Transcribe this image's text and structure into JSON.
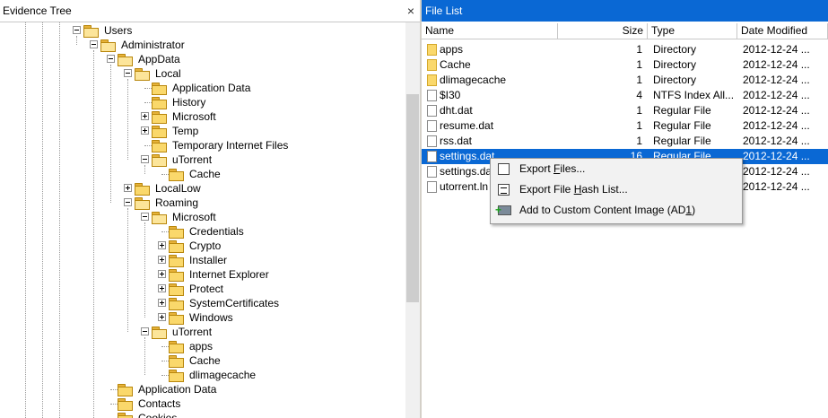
{
  "left_panel": {
    "title": "Evidence Tree",
    "close_glyph": "×"
  },
  "right_panel": {
    "title": "File List"
  },
  "tree": [
    {
      "label": "Users",
      "depth": 0,
      "expander": "minus",
      "open": true
    },
    {
      "label": "Administrator",
      "depth": 1,
      "expander": "minus",
      "open": true
    },
    {
      "label": "AppData",
      "depth": 2,
      "expander": "minus",
      "open": true
    },
    {
      "label": "Local",
      "depth": 3,
      "expander": "minus",
      "open": true
    },
    {
      "label": "Application Data",
      "depth": 4,
      "expander": "none"
    },
    {
      "label": "History",
      "depth": 4,
      "expander": "none"
    },
    {
      "label": "Microsoft",
      "depth": 4,
      "expander": "plus"
    },
    {
      "label": "Temp",
      "depth": 4,
      "expander": "plus"
    },
    {
      "label": "Temporary Internet Files",
      "depth": 4,
      "expander": "none"
    },
    {
      "label": "uTorrent",
      "depth": 4,
      "expander": "minus",
      "open": true
    },
    {
      "label": "Cache",
      "depth": 5,
      "expander": "none"
    },
    {
      "label": "LocalLow",
      "depth": 3,
      "expander": "plus"
    },
    {
      "label": "Roaming",
      "depth": 3,
      "expander": "minus",
      "open": true
    },
    {
      "label": "Microsoft",
      "depth": 4,
      "expander": "minus",
      "open": true
    },
    {
      "label": "Credentials",
      "depth": 5,
      "expander": "none"
    },
    {
      "label": "Crypto",
      "depth": 5,
      "expander": "plus"
    },
    {
      "label": "Installer",
      "depth": 5,
      "expander": "plus"
    },
    {
      "label": "Internet Explorer",
      "depth": 5,
      "expander": "plus"
    },
    {
      "label": "Protect",
      "depth": 5,
      "expander": "plus"
    },
    {
      "label": "SystemCertificates",
      "depth": 5,
      "expander": "plus"
    },
    {
      "label": "Windows",
      "depth": 5,
      "expander": "plus"
    },
    {
      "label": "uTorrent",
      "depth": 4,
      "expander": "minus",
      "open": true
    },
    {
      "label": "apps",
      "depth": 5,
      "expander": "none"
    },
    {
      "label": "Cache",
      "depth": 5,
      "expander": "none"
    },
    {
      "label": "dlimagecache",
      "depth": 5,
      "expander": "none"
    },
    {
      "label": "Application Data",
      "depth": 2,
      "expander": "none"
    },
    {
      "label": "Contacts",
      "depth": 2,
      "expander": "none"
    },
    {
      "label": "Cookies",
      "depth": 2,
      "expander": "none"
    }
  ],
  "columns": {
    "name": "Name",
    "size": "Size",
    "type": "Type",
    "date": "Date Modified"
  },
  "files": [
    {
      "name": "apps",
      "size": "1",
      "type": "Directory",
      "date": "2012-12-24 ...",
      "kind": "folder"
    },
    {
      "name": "Cache",
      "size": "1",
      "type": "Directory",
      "date": "2012-12-24 ...",
      "kind": "folder"
    },
    {
      "name": "dlimagecache",
      "size": "1",
      "type": "Directory",
      "date": "2012-12-24 ...",
      "kind": "folder"
    },
    {
      "name": "$I30",
      "size": "4",
      "type": "NTFS Index All...",
      "date": "2012-12-24 ...",
      "kind": "file"
    },
    {
      "name": "dht.dat",
      "size": "1",
      "type": "Regular File",
      "date": "2012-12-24 ...",
      "kind": "file"
    },
    {
      "name": "resume.dat",
      "size": "1",
      "type": "Regular File",
      "date": "2012-12-24 ...",
      "kind": "file"
    },
    {
      "name": "rss.dat",
      "size": "1",
      "type": "Regular File",
      "date": "2012-12-24 ...",
      "kind": "file"
    },
    {
      "name": "settings.dat",
      "size": "16",
      "type": "Regular File",
      "date": "2012-12-24 ...",
      "kind": "file",
      "selected": true
    },
    {
      "name": "settings.da",
      "size": "",
      "type": "",
      "date": "2012-12-24 ...",
      "kind": "file"
    },
    {
      "name": "utorrent.ln",
      "size": "",
      "type": "",
      "date": "2012-12-24 ...",
      "kind": "file"
    }
  ],
  "context_menu": [
    {
      "label_pre": "Export ",
      "label_ul": "F",
      "label_post": "iles...",
      "icon": "doc-icon"
    },
    {
      "label_pre": "Export File ",
      "label_ul": "H",
      "label_post": "ash List...",
      "icon": "hash-list-icon"
    },
    {
      "label_pre": "Add to Custom Content Image (AD",
      "label_ul": "1",
      "label_post": ")",
      "icon": "add-image-icon"
    }
  ],
  "colors": {
    "selection": "#0a68d4",
    "folder": "#fad86b"
  }
}
